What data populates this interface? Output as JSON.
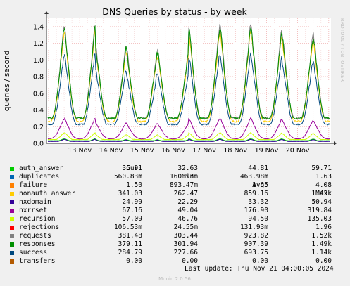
{
  "chart_data": {
    "type": "line",
    "title": "DNS Queries by status - by week",
    "ylabel": "queries / second",
    "side_text": "RRDTOOL / TOBI OETIKER",
    "footer": "Munin 2.0.56",
    "y_ticks": [
      "0.0",
      "0.2",
      "0.4",
      "0.6",
      "0.8",
      "1.0",
      "1.2",
      "1.4"
    ],
    "ylim": [
      0,
      1.5
    ],
    "x_ticks": [
      "13 Nov",
      "14 Nov",
      "15 Nov",
      "16 Nov",
      "17 Nov",
      "18 Nov",
      "19 Nov",
      "20 Nov"
    ],
    "grid": true,
    "peaks": [
      {
        "day": "12 Nov",
        "value": 1.38
      },
      {
        "day": "13 Nov",
        "value": 1.43
      },
      {
        "day": "14 Nov",
        "value": 1.18
      },
      {
        "day": "15 Nov",
        "value": 1.12
      },
      {
        "day": "16 Nov",
        "value": 1.1
      },
      {
        "day": "17 Nov",
        "value": 1.4
      },
      {
        "day": "18 Nov",
        "value": 1.43
      },
      {
        "day": "19 Nov",
        "value": 1.38
      },
      {
        "day": "20 Nov",
        "value": 1.3
      }
    ],
    "columns": [
      "Cur:",
      "Min:",
      "Avg:",
      "Max:"
    ],
    "series": [
      {
        "name": "auth_answer",
        "color": "#00cc00",
        "cur": "35.91",
        "min": "32.63",
        "avg": "44.81",
        "max": "59.71"
      },
      {
        "name": "duplicates",
        "color": "#0066b3",
        "cur": "560.83m",
        "min": "160.93m",
        "avg": "463.98m",
        "max": "1.63"
      },
      {
        "name": "failure",
        "color": "#ff8000",
        "cur": "1.50",
        "min": "893.47m",
        "avg": "1.65",
        "max": "4.08"
      },
      {
        "name": "nonauth_answer",
        "color": "#ffcc00",
        "cur": "341.03",
        "min": "262.47",
        "avg": "859.16",
        "max": "1.43k"
      },
      {
        "name": "nxdomain",
        "color": "#330099",
        "cur": "24.99",
        "min": "22.29",
        "avg": "33.32",
        "max": "50.94"
      },
      {
        "name": "nxrrset",
        "color": "#990099",
        "cur": "67.16",
        "min": "49.04",
        "avg": "176.90",
        "max": "319.84"
      },
      {
        "name": "recursion",
        "color": "#ccff00",
        "cur": "57.09",
        "min": "46.76",
        "avg": "94.50",
        "max": "135.03"
      },
      {
        "name": "rejections",
        "color": "#ff0000",
        "cur": "106.53m",
        "min": "24.55m",
        "avg": "131.93m",
        "max": "1.96"
      },
      {
        "name": "requests",
        "color": "#808080",
        "cur": "381.48",
        "min": "303.44",
        "avg": "923.82",
        "max": "1.52k"
      },
      {
        "name": "responses",
        "color": "#008f00",
        "cur": "379.11",
        "min": "301.94",
        "avg": "907.39",
        "max": "1.49k"
      },
      {
        "name": "success",
        "color": "#00487d",
        "cur": "284.79",
        "min": "227.66",
        "avg": "693.75",
        "max": "1.14k"
      },
      {
        "name": "transfers",
        "color": "#b35a00",
        "cur": "0.00",
        "min": "0.00",
        "avg": "0.00",
        "max": "0.00"
      }
    ],
    "last_update": "Last update: Thu Nov 21 04:00:05 2024"
  }
}
